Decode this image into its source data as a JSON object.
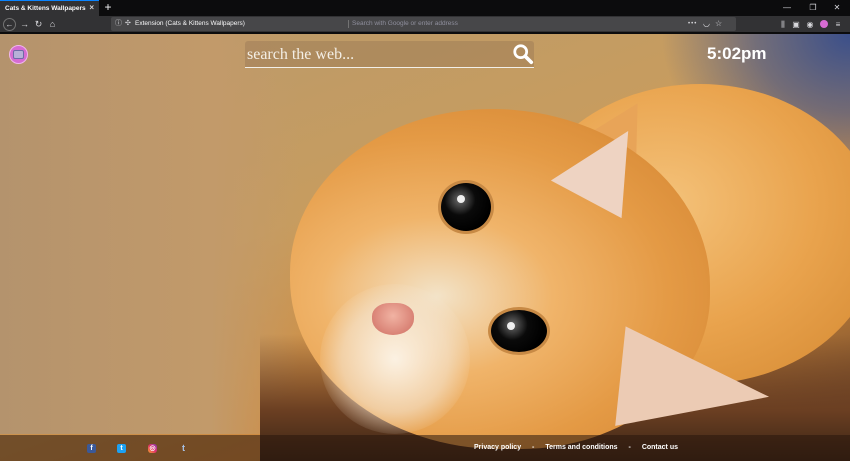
{
  "tab": {
    "title": "Cats & Kittens Wallpapers",
    "close": "×",
    "new_tab": "+"
  },
  "window_controls": {
    "minimize": "—",
    "maximize": "❐",
    "close": "✕"
  },
  "nav": {
    "back": "←",
    "forward": "→",
    "reload": "↻",
    "home": "⌂"
  },
  "urlbar": {
    "identity": "Extension (Cats & Kittens Wallpapers)",
    "placeholder": "Search with Google or enter address",
    "value": "",
    "actions": {
      "page_actions": "•••",
      "pocket": "◡",
      "bookmark": "☆"
    }
  },
  "toolbar_icons": [
    "library-icon",
    "sidebar-icon",
    "account-icon",
    "extension-icon",
    "menu-icon"
  ],
  "page": {
    "search": {
      "placeholder": "search the web..."
    },
    "clock": "5:02pm"
  },
  "footer": {
    "social": [
      {
        "name": "facebook",
        "glyph": "f",
        "color": "#3b5998"
      },
      {
        "name": "twitter",
        "glyph": "t",
        "color": "#1da1f2"
      },
      {
        "name": "instagram",
        "glyph": "◎",
        "color": "#e1306c"
      },
      {
        "name": "tumblr",
        "glyph": "t",
        "color": "#a9c5ea"
      }
    ],
    "links": {
      "privacy": "Privacy policy",
      "terms": "Terms and conditions",
      "contact": "Contact us",
      "separator": "-"
    }
  }
}
